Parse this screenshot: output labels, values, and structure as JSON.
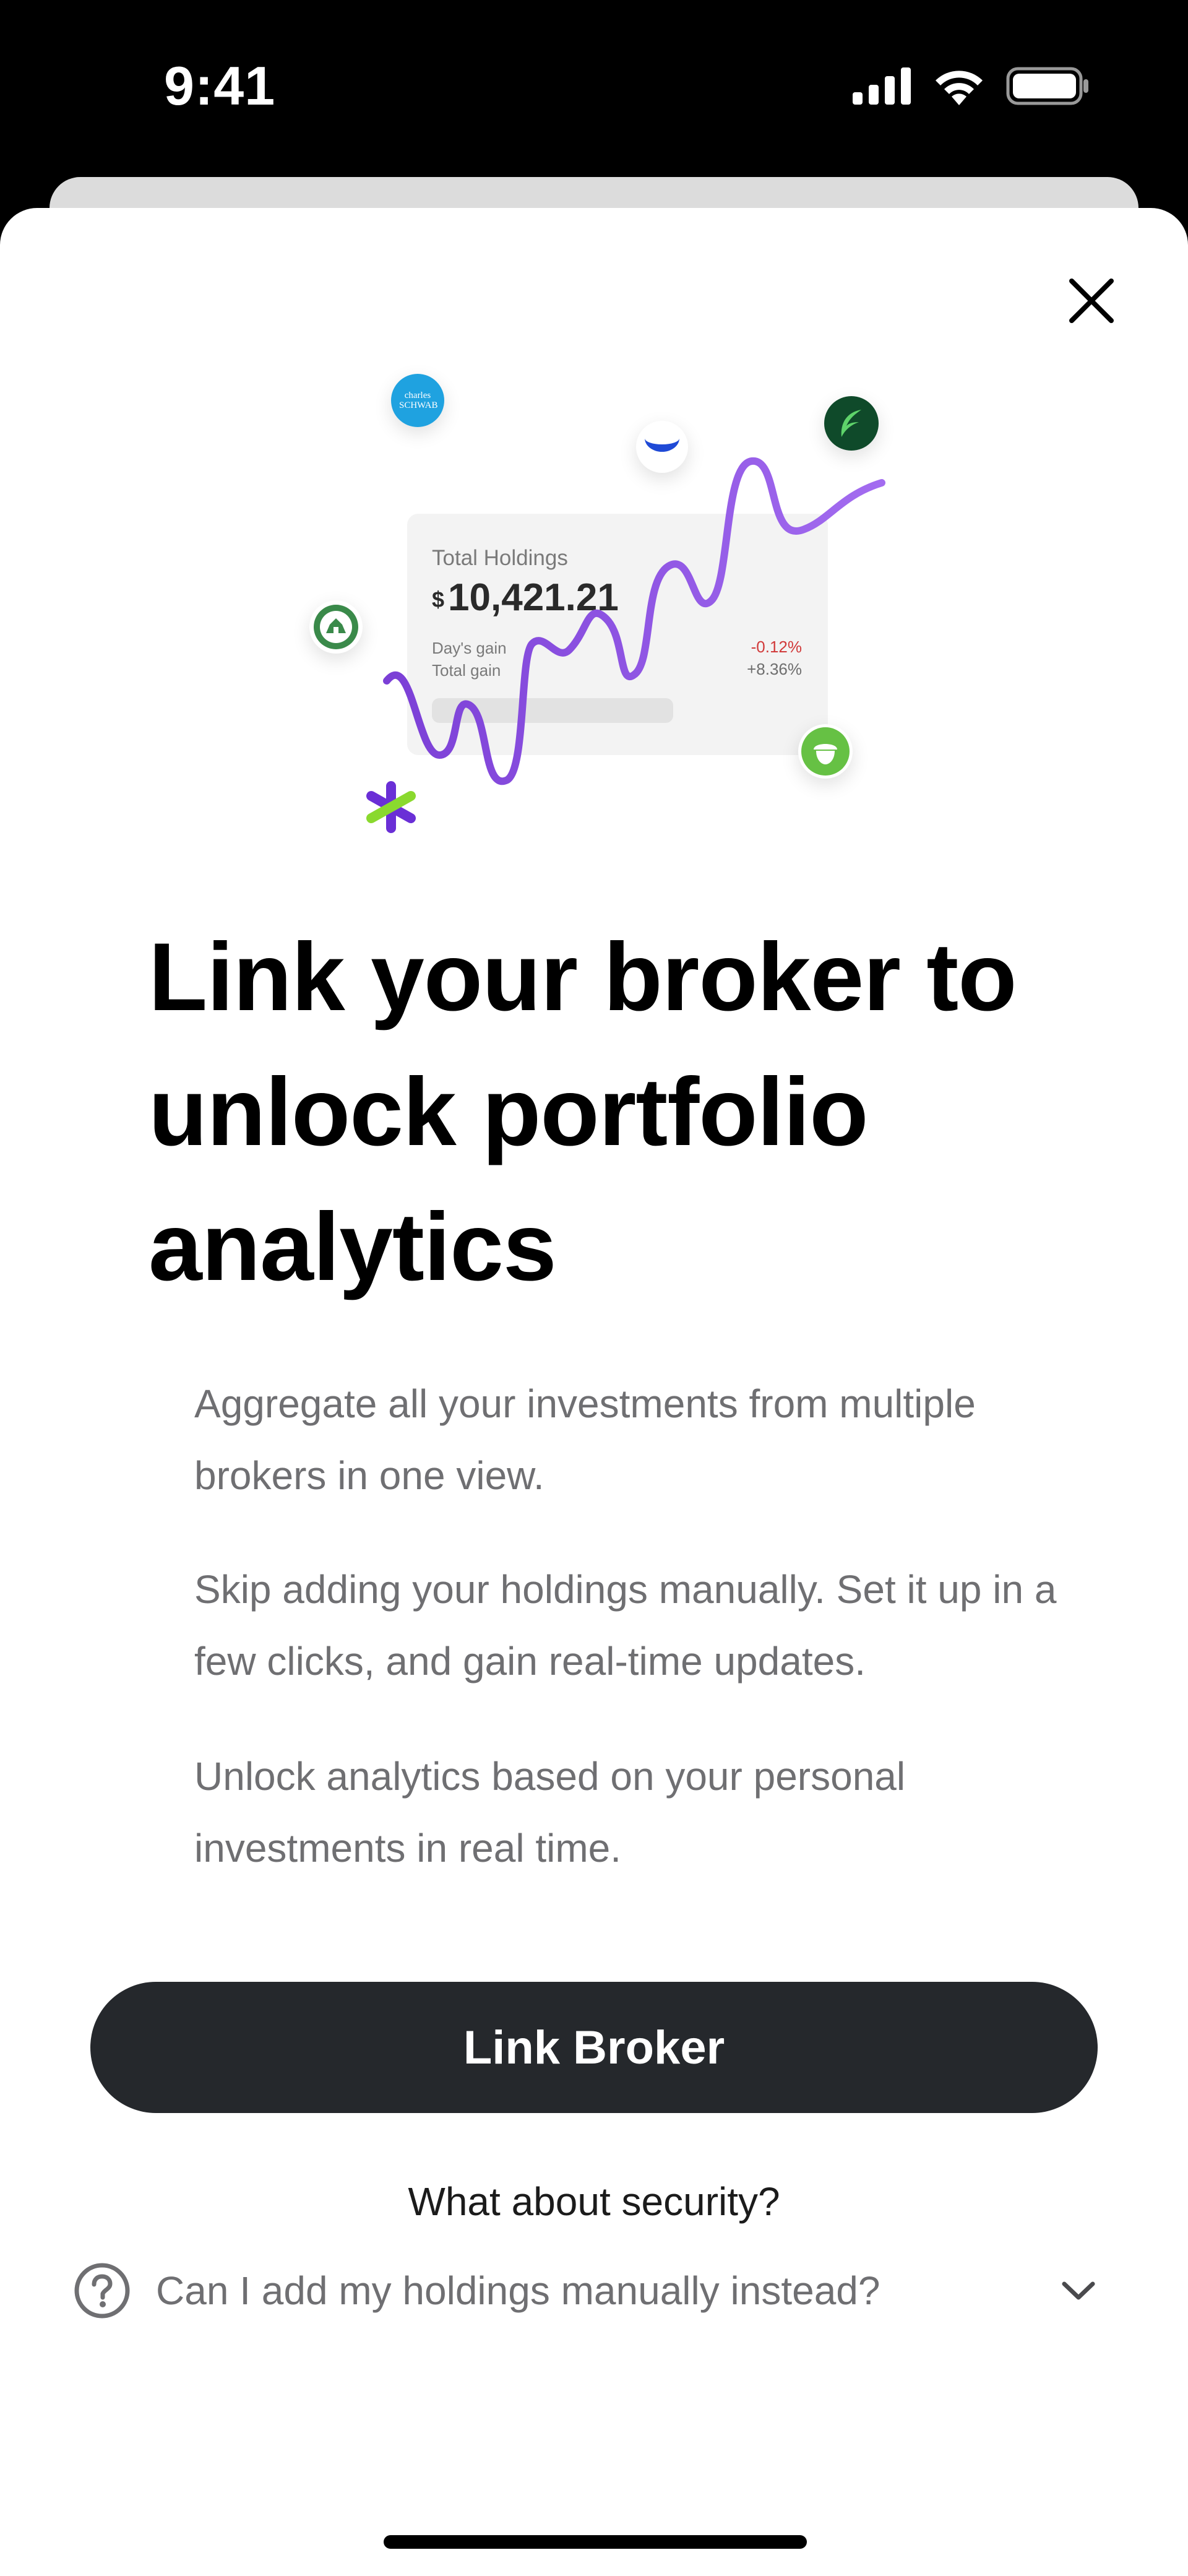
{
  "status_bar": {
    "time": "9:41",
    "icons": [
      "cellular-signal-icon",
      "wifi-icon",
      "battery-icon"
    ]
  },
  "modal": {
    "close_icon": "close-icon",
    "illustration": {
      "card": {
        "title": "Total Holdings",
        "currency": "$",
        "amount": "10,421.21",
        "days_gain_label": "Day's gain",
        "total_gain_label": "Total gain",
        "days_gain_value": "-0.12%",
        "total_gain_value": "+8.36%"
      },
      "broker_logos": {
        "schwab_text": "charles SCHWAB"
      },
      "colors": {
        "line": "#8a4fe0",
        "loss": "#d13a3a"
      }
    },
    "headline": "Link your broker to unlock portfolio analytics",
    "paragraphs": [
      "Aggregate all your investments from multiple brokers in one view.",
      "Skip adding your holdings manually. Set it up in a few clicks, and gain real-time updates.",
      "Unlock analytics based on your personal investments in real time."
    ],
    "cta_label": "Link Broker",
    "security_link": "What about security?",
    "faq": {
      "question": "Can I add my holdings manually instead?"
    }
  },
  "colors": {
    "cta_background": "#25282c",
    "body_text": "#6f6f72"
  }
}
